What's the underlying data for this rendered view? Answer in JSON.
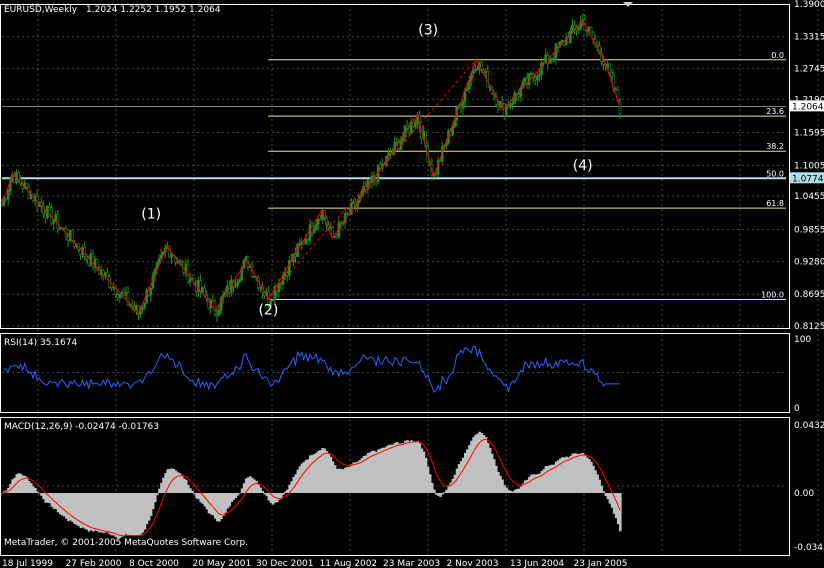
{
  "colors": {
    "background": "#000000",
    "grid": "#2f4f4f",
    "candle": "#228b22",
    "zigzag": "#ff0000",
    "fib": "#e6e68c",
    "fib_level_50": "#b0e0e6",
    "rsi": "#3060ff",
    "macd_hist": "#c0c0c0",
    "macd_signal": "#ff0000",
    "frame": "#ffffff",
    "price_box_bg": "#ffffff",
    "price_box_fg": "#000000"
  },
  "chart_data": [
    {
      "type": "candlestick",
      "title": "EURUSD,Weekly",
      "ohlc_header": "1.2024 1.2252 1.1952 1.2064",
      "ylim": [
        0.8125,
        1.39
      ],
      "y_ticks": [
        "1.3900",
        "1.3315",
        "1.2745",
        "1.2190",
        "1.1595",
        "1.1005",
        "1.0455",
        "0.9855",
        "0.9280",
        "0.8695",
        "0.8125"
      ],
      "current_price": "1.2064",
      "level_label": "1.0774",
      "x_labels": [
        "18 Jul 1999",
        "27 Feb 2000",
        "8 Oct 2000",
        "20 May 2001",
        "30 Dec 2001",
        "11 Aug 2002",
        "23 Mar 2003",
        "2 Nov 2003",
        "13 Jun 2004",
        "23 Jan 2005"
      ],
      "zigzag_points": [
        [
          1999.5,
          1.03
        ],
        [
          1999.6,
          1.085
        ],
        [
          2000.78,
          0.835
        ],
        [
          2001.05,
          0.955
        ],
        [
          2001.5,
          0.84
        ],
        [
          2001.8,
          0.93
        ],
        [
          2002.0,
          0.86
        ],
        [
          2002.5,
          1.02
        ],
        [
          2002.6,
          0.97
        ],
        [
          2003.4,
          1.19
        ],
        [
          2003.55,
          1.08
        ],
        [
          2003.95,
          1.29
        ],
        [
          2004.2,
          1.2
        ],
        [
          2004.95,
          1.36
        ],
        [
          2005.15,
          1.29
        ],
        [
          2005.3,
          1.205
        ]
      ],
      "dashed_line": [
        [
          2001.98,
          0.86
        ],
        [
          2003.95,
          1.29
        ]
      ],
      "fib_levels": [
        {
          "label": "0.0",
          "value": 1.29
        },
        {
          "label": "23.6",
          "value": 1.189
        },
        {
          "label": "38.2",
          "value": 1.126
        },
        {
          "label": "50.0",
          "value": 1.0774
        },
        {
          "label": "61.8",
          "value": 1.024
        },
        {
          "label": "100.0",
          "value": 0.86
        }
      ],
      "wave_labels": [
        {
          "text": "(1)",
          "x": 2000.9,
          "y": 1.005
        },
        {
          "text": "(2)",
          "x": 2002.0,
          "y": 0.833
        },
        {
          "text": "(3)",
          "x": 2003.5,
          "y": 1.335
        },
        {
          "text": "(4)",
          "x": 2004.95,
          "y": 1.092
        }
      ]
    },
    {
      "type": "line",
      "title": "RSI(14) 35.1674",
      "ylim": [
        0,
        100
      ],
      "y_ticks": [
        "100",
        "0"
      ]
    },
    {
      "type": "bar",
      "title": "MACD(12,26,9) -0.02474 -0.01763",
      "ylim": [
        -0.03432,
        0.04323
      ],
      "y_ticks": [
        "0.04323",
        "0.00",
        "-0.03432"
      ]
    }
  ],
  "footer": {
    "copyright": "MetaTrader, © 2001-2005 MetaQuotes Software Corp."
  }
}
